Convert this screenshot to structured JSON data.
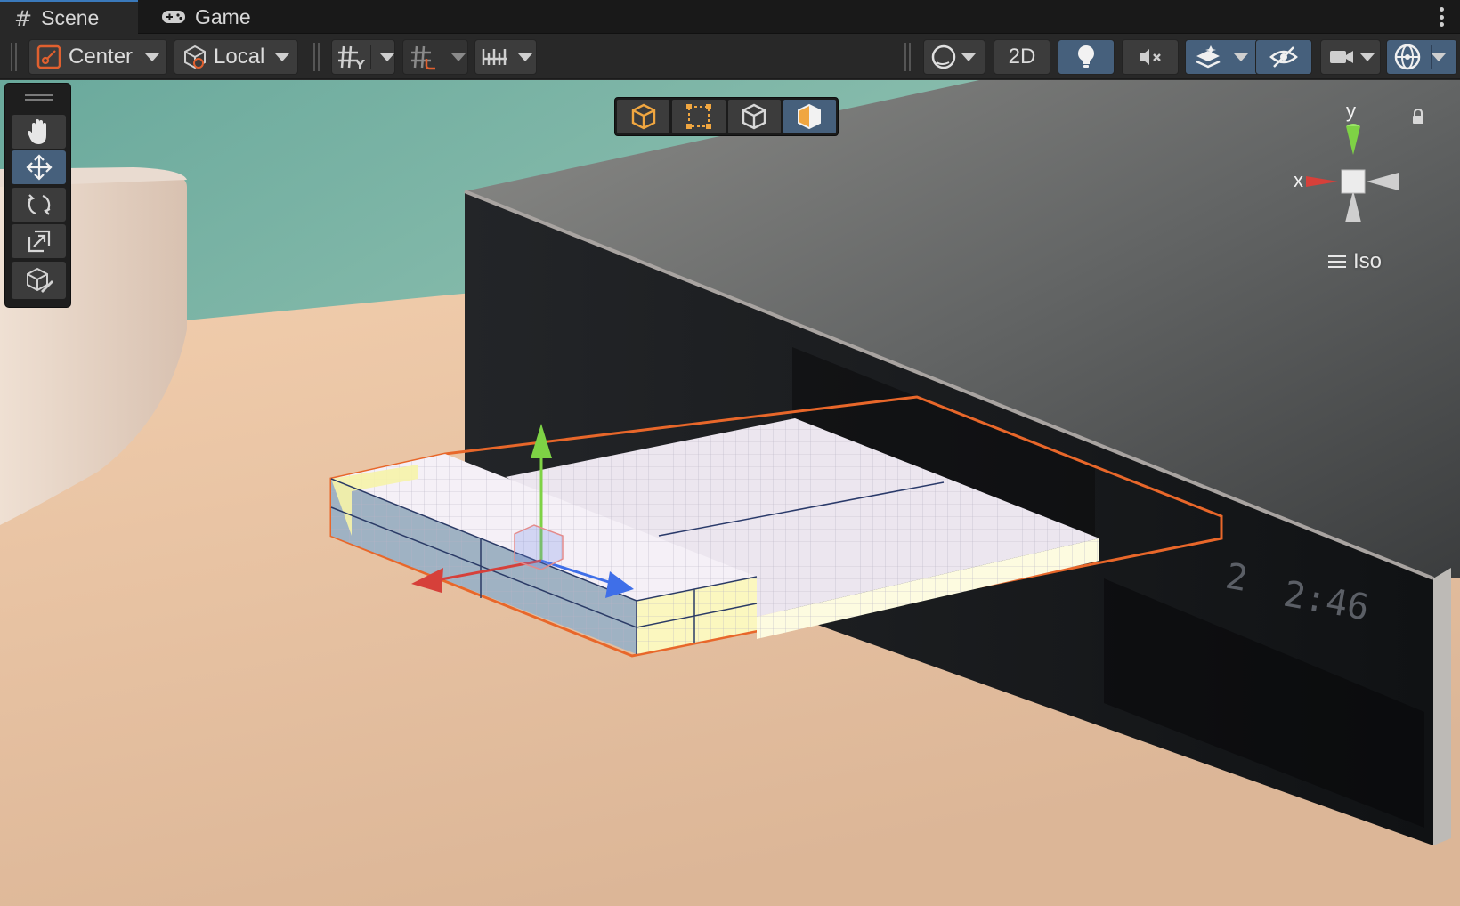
{
  "tabs": [
    {
      "label": "Scene",
      "icon": "hash-icon",
      "active": true
    },
    {
      "label": "Game",
      "icon": "gamepad-icon",
      "active": false
    }
  ],
  "toolbar": {
    "pivot_label": "Center",
    "handle_rotation_label": "Local",
    "mode_2d_label": "2D",
    "icons": [
      "pivot-icon",
      "local-cube-icon",
      "grid-icon",
      "snap-increment-icon",
      "ruler-icon",
      "draw-mode-sphere-icon",
      "lighting-bulb-icon",
      "audio-mute-icon",
      "effects-icon",
      "hidden-visibility-icon",
      "camera-icon",
      "gizmos-icon"
    ]
  },
  "tools": [
    {
      "name": "view-tool",
      "icon": "hand-icon",
      "active": false
    },
    {
      "name": "move-tool",
      "icon": "move-arrows-icon",
      "active": true
    },
    {
      "name": "rotate-tool",
      "icon": "rotate-icon",
      "active": false
    },
    {
      "name": "scale-tool",
      "icon": "scale-icon",
      "active": false
    },
    {
      "name": "custom-editor-tool",
      "icon": "cube-pencil-icon",
      "active": false
    }
  ],
  "context_tools": [
    "transform-cube-icon",
    "rect-tool-icon",
    "wire-cube-icon",
    "shaded-cube-icon"
  ],
  "gizmo": {
    "x_label": "x",
    "y_label": "y",
    "projection_label": "Iso"
  },
  "colors": {
    "accent_blue": "#46607c",
    "axis_x": "#d6403a",
    "axis_y": "#7ed245",
    "axis_z": "#3f6fe8",
    "selection_outline": "#e8672a"
  }
}
